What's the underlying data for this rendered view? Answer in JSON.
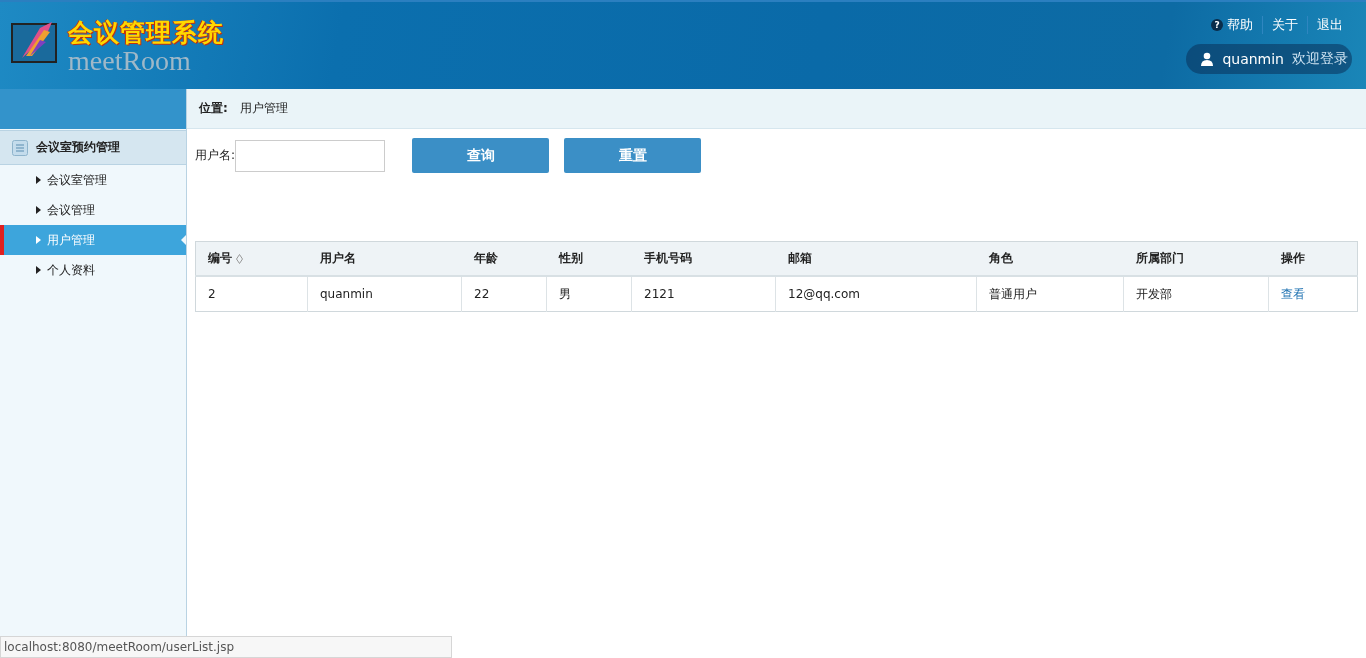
{
  "header": {
    "title": "会议管理系统",
    "subtitle": "meetRoom",
    "links": [
      {
        "label": "帮助",
        "icon": "?"
      },
      {
        "label": "关于"
      },
      {
        "label": "退出"
      }
    ],
    "user": "quanmin",
    "welcome": "欢迎登录"
  },
  "sidebar": {
    "group": "会议室预约管理",
    "items": [
      {
        "label": "会议室管理",
        "selected": false
      },
      {
        "label": "会议管理",
        "selected": false
      },
      {
        "label": "用户管理",
        "selected": true
      },
      {
        "label": "个人资料",
        "selected": false
      }
    ]
  },
  "breadcrumb": {
    "label": "位置:",
    "value": "用户管理"
  },
  "search": {
    "label": "用户名:",
    "buttons": [
      "查询",
      "重置"
    ]
  },
  "table": {
    "columns": [
      {
        "label": "编号",
        "sortable": true
      },
      {
        "label": "用户名"
      },
      {
        "label": "年龄"
      },
      {
        "label": "性别"
      },
      {
        "label": "手机号码"
      },
      {
        "label": "邮箱"
      },
      {
        "label": "角色"
      },
      {
        "label": "所属部门"
      },
      {
        "label": "操作"
      }
    ],
    "rows": [
      {
        "cells": [
          "2",
          "quanmin",
          "22",
          "男",
          "2121",
          "12@qq.com",
          "普通用户",
          "开发部"
        ],
        "action": "查看"
      }
    ]
  },
  "status_bar": "localhost:8080/meetRoom/userList.jsp"
}
